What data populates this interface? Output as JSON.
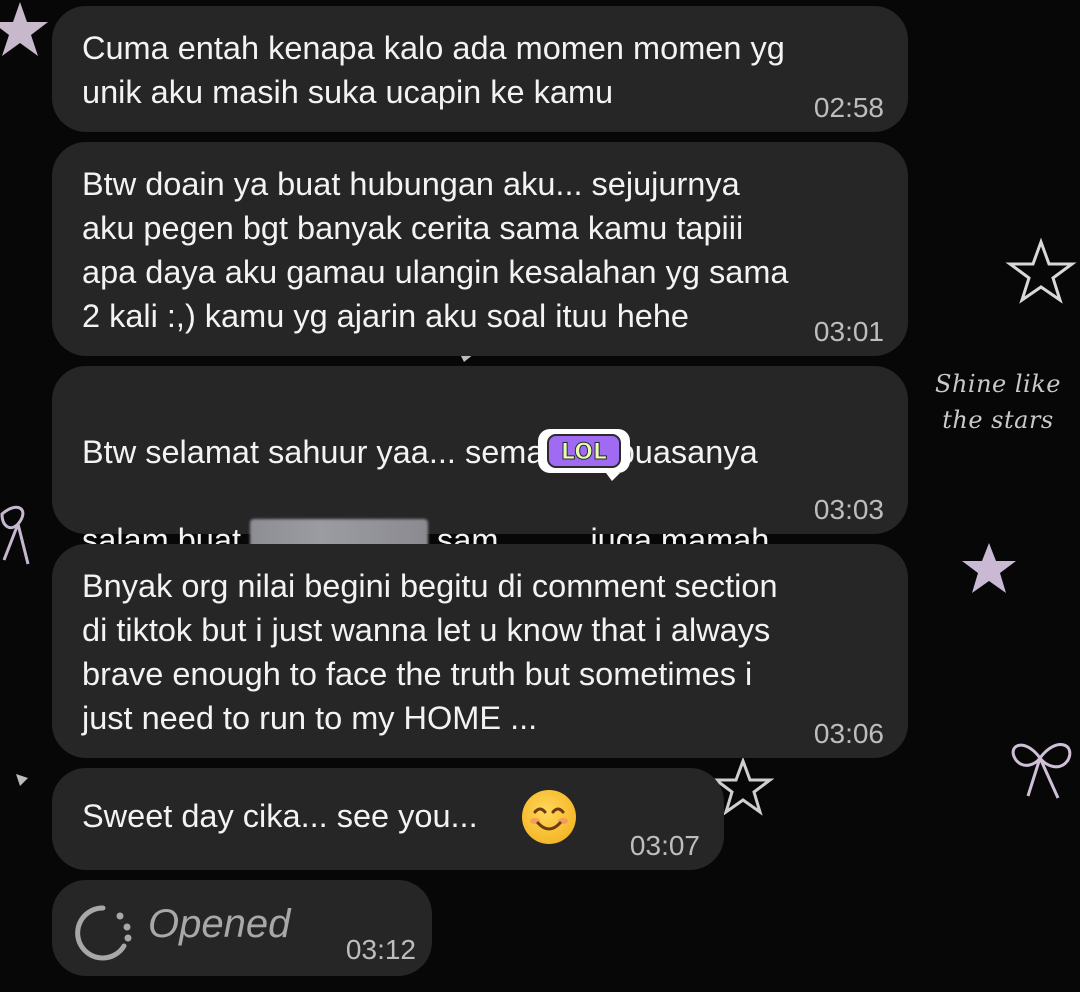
{
  "wallpaper": {
    "caption_line1": "Shine like",
    "caption_line2": "the stars"
  },
  "messages": [
    {
      "text": "Cuma entah kenapa kalo ada momen momen yg\nunik aku masih suka ucapin ke kamu",
      "time": "02:58"
    },
    {
      "text": "Btw doain ya buat hubungan aku... sejujurnya\naku pegen bgt banyak cerita sama kamu tapiii\napa daya aku gamau ulangin kesalahan yg sama\n2 kali :,) kamu yg ajarin aku soal ituu hehe",
      "time": "03:01"
    },
    {
      "line1": "Btw selamat sahuur yaa... semangat puasanya",
      "line2_a": "salam buat ",
      "line2_b": " sam",
      "line2_c": "juga mamah",
      "time": "03:03"
    },
    {
      "text": "Bnyak org nilai begini begitu di comment section\ndi tiktok but i just wanna let u know that i always\nbrave enough to face the truth but sometimes i\njust need to run to my HOME ...",
      "time": "03:06"
    },
    {
      "text": "Sweet day cika... see you...",
      "time": "03:07"
    }
  ],
  "stickers": {
    "lol_text": "LOL",
    "emoji": "smiling-face-emoji"
  },
  "status": {
    "label": "Opened",
    "time": "03:12",
    "icon": "opened-snap-icon"
  },
  "colors": {
    "background": "#070707",
    "bubble": "#262626",
    "text": "#f3f3f3",
    "time": "#bdbdbd",
    "lol_purple": "#a06bf2"
  }
}
